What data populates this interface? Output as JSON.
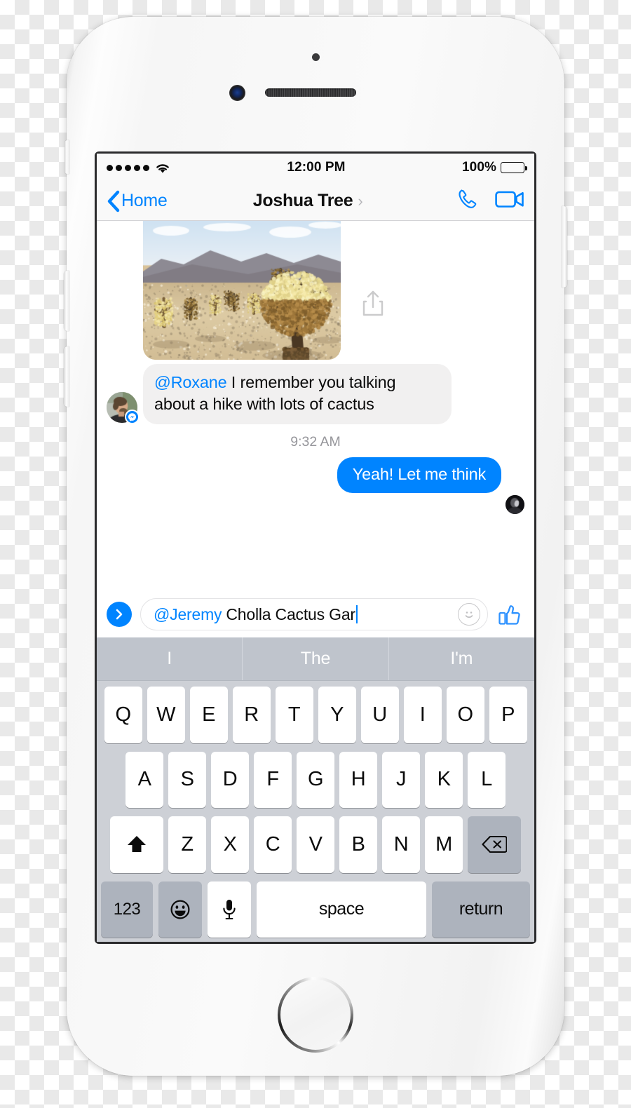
{
  "status_bar": {
    "signal_dots": 5,
    "wifi_icon": "wifi-icon",
    "time": "12:00 PM",
    "battery_percent": "100%",
    "battery_icon": "battery-full-icon"
  },
  "nav_bar": {
    "back_icon": "chevron-left-icon",
    "back_label": "Home",
    "title": "Joshua Tree",
    "title_chevron": "chevron-right-icon",
    "call_icon": "phone-icon",
    "video_icon": "video-camera-icon"
  },
  "conversation": {
    "photo_message": {
      "alt": "Cholla cactus garden in desert with mountains",
      "share_icon": "share-upload-icon"
    },
    "incoming_message": {
      "avatar": "sender-avatar",
      "badge_icon": "messenger-bolt-icon",
      "mention": "@Roxane",
      "text": " I remember you talking about a hike with lots of cactus"
    },
    "timestamp": "9:32 AM",
    "outgoing_message": {
      "text": "Yeah! Let me think",
      "seen_avatar": "seen-by-avatar"
    }
  },
  "composer": {
    "send_icon": "chevron-right-send-icon",
    "input_mention": "@Jeremy",
    "input_value": "Cholla Cactus Gar",
    "emoji_icon": "smiley-face-icon",
    "thumbs_up_icon": "thumbs-up-icon"
  },
  "keyboard": {
    "suggestions": [
      "I",
      "The",
      "I'm"
    ],
    "row1": [
      "Q",
      "W",
      "E",
      "R",
      "T",
      "Y",
      "U",
      "I",
      "O",
      "P"
    ],
    "row2": [
      "A",
      "S",
      "D",
      "F",
      "G",
      "H",
      "J",
      "K",
      "L"
    ],
    "row3_letters": [
      "Z",
      "X",
      "C",
      "V",
      "B",
      "N",
      "M"
    ],
    "shift_icon": "shift-arrow-up-icon",
    "backspace_icon": "backspace-delete-icon",
    "numbers_label": "123",
    "emoji_icon": "smiley-keyboard-icon",
    "mic_icon": "microphone-icon",
    "space_label": "space",
    "return_label": "return"
  },
  "colors": {
    "messenger_blue": "#0084FF",
    "incoming_bubble": "#F1F0F0",
    "keyboard_bg": "#CDD0D6",
    "suggestion_bg": "#BFC4CC"
  }
}
